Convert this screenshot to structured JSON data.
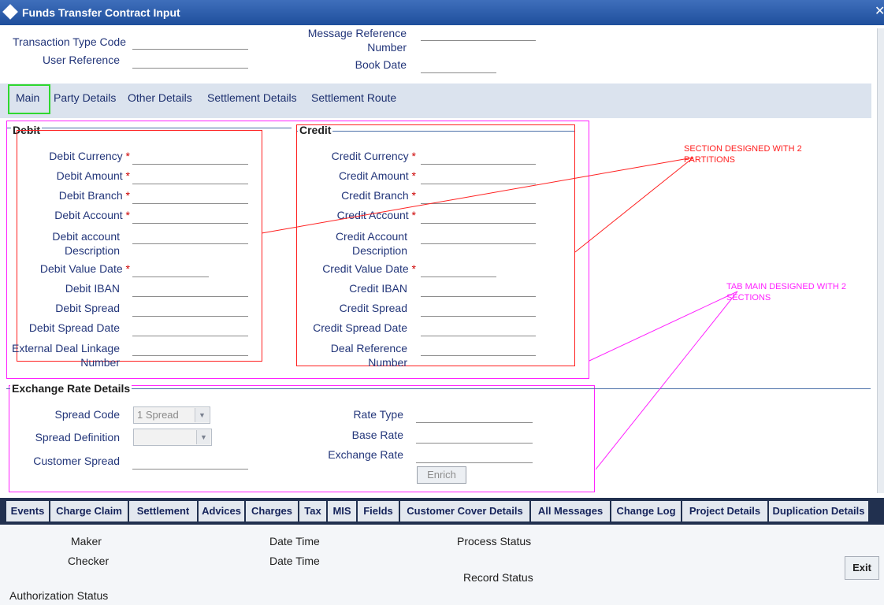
{
  "window": {
    "title": "Funds Transfer Contract Input",
    "close_glyph": "✕"
  },
  "header": {
    "transaction_type_code": "Transaction Type Code",
    "user_reference": "User Reference",
    "message_reference": "Message Reference Number",
    "book_date": "Book Date"
  },
  "tabs": [
    "Main",
    "Party Details",
    "Other Details",
    "Settlement Details",
    "Settlement Route"
  ],
  "debit": {
    "title": "Debit",
    "currency": "Debit Currency",
    "amount": "Debit Amount",
    "branch": "Debit Branch",
    "account": "Debit Account",
    "account_desc": "Debit account Description",
    "value_date": "Debit Value Date",
    "iban": "Debit IBAN",
    "spread": "Debit Spread",
    "spread_date": "Debit Spread Date",
    "ext_deal": "External Deal Linkage Number"
  },
  "credit": {
    "title": "Credit",
    "currency": "Credit Currency",
    "amount": "Credit Amount",
    "branch": "Credit Branch",
    "account": "Credit Account",
    "account_desc": "Credit Account Description",
    "value_date": "Credit Value Date",
    "iban": "Credit IBAN",
    "spread": "Credit Spread",
    "spread_date": "Credit Spread Date",
    "deal_ref": "Deal Reference Number"
  },
  "required_mark": "*",
  "exchange": {
    "title": "Exchange Rate Details",
    "spread_code": "Spread Code",
    "spread_code_value": "1 Spread",
    "spread_definition": "Spread Definition",
    "customer_spread": "Customer Spread",
    "rate_type": "Rate Type",
    "base_rate": "Base Rate",
    "exchange_rate": "Exchange Rate",
    "enrich": "Enrich"
  },
  "annotations": {
    "section_partitions": "SECTION DESIGNED WITH 2 PARTITIONS",
    "tab_sections": "TAB MAIN DESIGNED WITH 2 SECTIONS"
  },
  "buttons": [
    "Events",
    "Charge Claim",
    "Settlement",
    "Advices",
    "Charges",
    "Tax",
    "MIS",
    "Fields",
    "Customer Cover Details",
    "All Messages",
    "Change Log",
    "Project Details",
    "Duplication Details"
  ],
  "footer": {
    "maker": "Maker",
    "checker": "Checker",
    "date_time_1": "Date Time",
    "date_time_2": "Date Time",
    "process_status": "Process Status",
    "record_status": "Record Status",
    "authorization_status": "Authorization Status",
    "exit": "Exit"
  },
  "colors": {
    "title_bar": "#2a5aa8",
    "button_bar": "#21304f",
    "annotation_red": "#ff2020",
    "annotation_magenta": "#ff22ff",
    "active_tab_outline": "#2fd82f"
  }
}
